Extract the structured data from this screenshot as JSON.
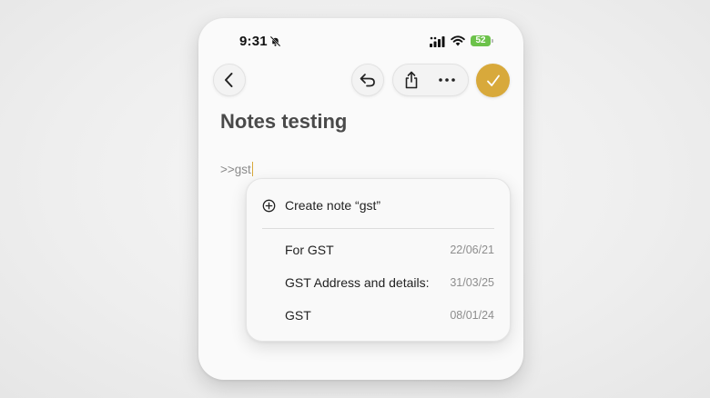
{
  "status_bar": {
    "time": "9:31",
    "battery": "52"
  },
  "icons": {
    "back": "chevron-left-icon",
    "undo": "undo-icon",
    "share": "share-icon",
    "more": "ellipsis-icon",
    "done": "checkmark-icon",
    "create": "plus-circle-icon",
    "silent": "bell-slash-icon"
  },
  "colors": {
    "accent": "#d8a93b",
    "battery": "#6cc24a"
  },
  "note": {
    "title": "Notes testing",
    "body": ">>gst"
  },
  "link_popup": {
    "create_label": "Create note “gst”",
    "results": [
      {
        "title": "For GST",
        "date": "22/06/21"
      },
      {
        "title": "GST Address and details:",
        "date": "31/03/25"
      },
      {
        "title": "GST",
        "date": "08/01/24"
      }
    ]
  }
}
